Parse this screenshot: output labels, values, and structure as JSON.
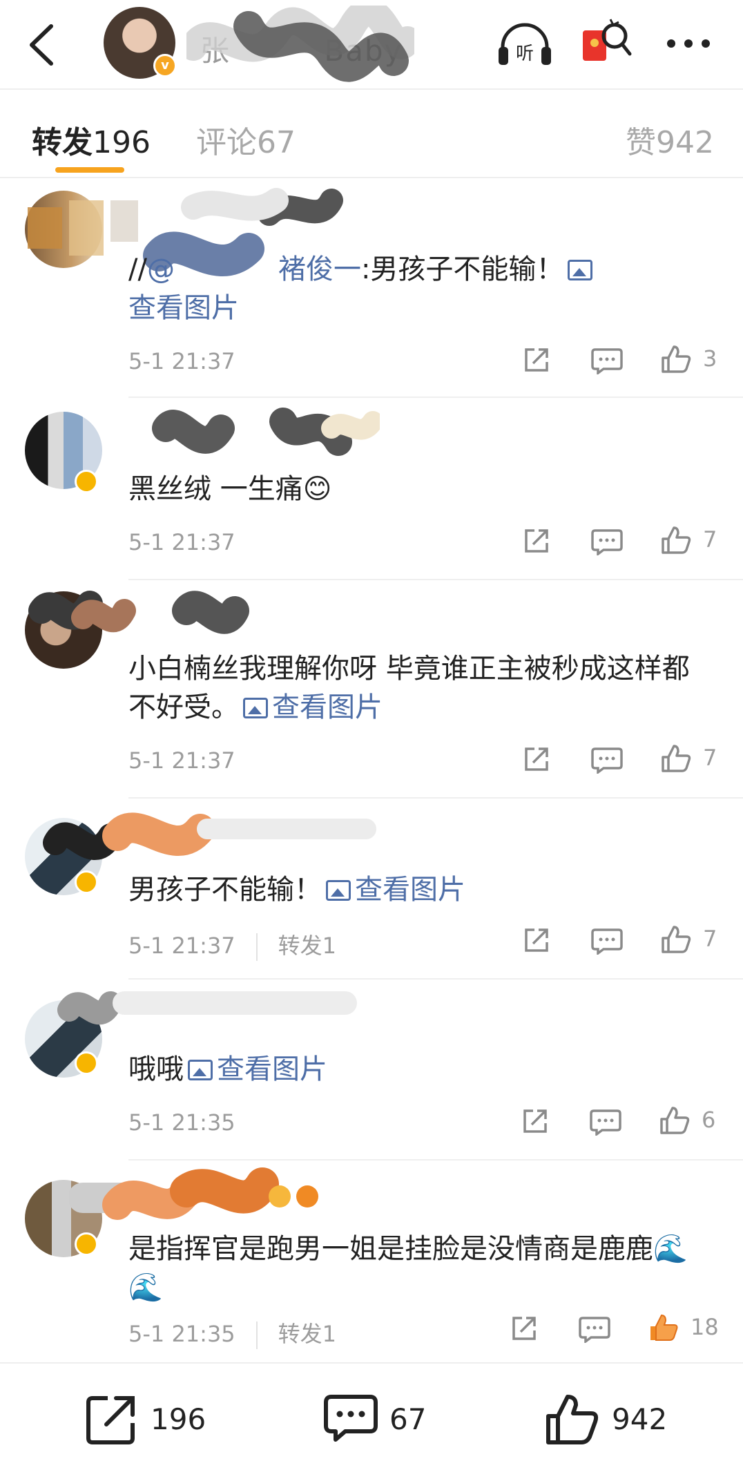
{
  "header": {
    "name_fragment": "张",
    "name_fragment_2": "Baby",
    "listen_label": "听",
    "icons": [
      "back-arrow-icon",
      "headphones-icon",
      "red-packet-icon",
      "more-icon"
    ]
  },
  "tabs": [
    {
      "label": "转发",
      "count": "196"
    },
    {
      "label": "评论",
      "count": "67"
    },
    {
      "label": "赞",
      "count": "942"
    }
  ],
  "comments": [
    {
      "text_prefix": "//",
      "mention": "@",
      "mention_tail": "褚俊一",
      "text": ":男孩子不能输！",
      "link": "查看图片",
      "time": "5-1 21:37",
      "repost": "",
      "likes": "3"
    },
    {
      "text": "黑丝绒 一生痛😊",
      "link": "",
      "time": "5-1 21:37",
      "repost": "",
      "likes": "7"
    },
    {
      "text": "小白楠丝我理解你呀 毕竟谁正主被秒成这样都不好受。",
      "link": "查看图片",
      "time": "5-1 21:37",
      "repost": "",
      "likes": "7"
    },
    {
      "text": "男孩子不能输！",
      "link": "查看图片",
      "time": "5-1 21:37",
      "repost": "转发1",
      "likes": "7"
    },
    {
      "text": "哦哦",
      "link": "查看图片",
      "time": "5-1 21:35",
      "repost": "",
      "likes": "6"
    },
    {
      "text": "是指挥官是跑男一姐是挂脸是没情商是鹿鹿🌊🌊",
      "link": "",
      "time": "5-1 21:35",
      "repost": "转发1",
      "likes": "18"
    }
  ],
  "bottom_bar": {
    "repost_count": "196",
    "comment_count": "67",
    "like_count": "942"
  },
  "colors": {
    "accent": "#f7a31e",
    "link": "#4e6ea7",
    "like_active": "#f08a24",
    "meta_grey": "#9c9c9c"
  }
}
